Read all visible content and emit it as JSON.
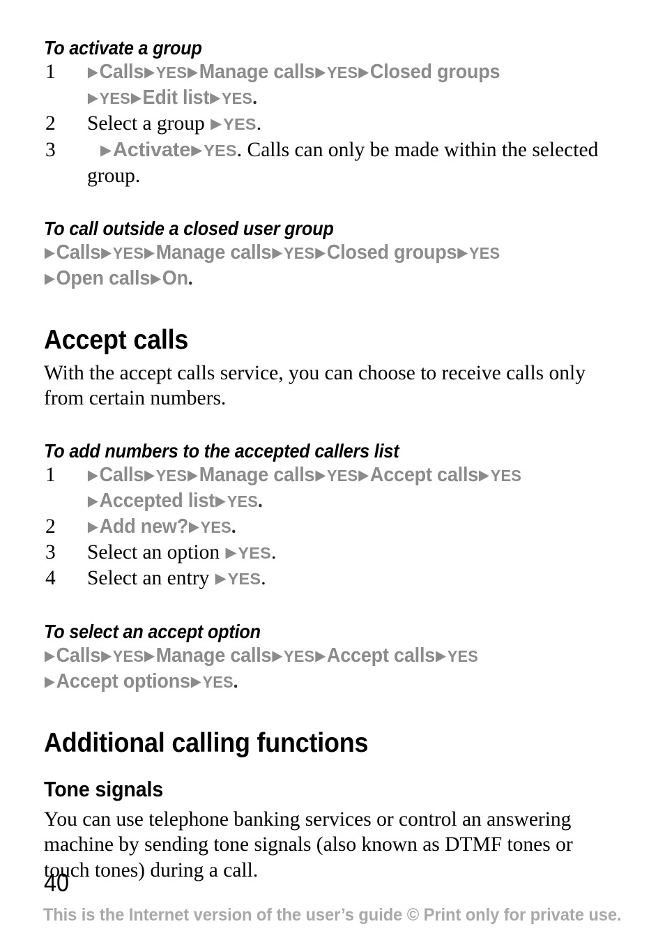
{
  "document": {
    "page_number": "40",
    "footer_notice": "This is the Internet version of the user’s guide © Print only for private use.",
    "colors": {
      "menu_path_grey": "#8b8b8b",
      "footer_grey": "#a9a9a9",
      "text_black": "#000000",
      "page_background": "#ffffff"
    },
    "arrow_glyph": "▶"
  },
  "sections": [
    {
      "id": "to-activate-a-group",
      "heading": "To activate a group",
      "heading_level": "h3",
      "steps": [
        {
          "number": "1",
          "lines": [
            {
              "type": "path",
              "tokens": [
                {
                  "t": "arrow"
                },
                {
                  "t": "label",
                  "v": "Calls"
                },
                {
                  "t": "arrow"
                },
                {
                  "t": "yes",
                  "v": "YES"
                },
                {
                  "t": "arrow"
                },
                {
                  "t": "label",
                  "v": "Manage calls"
                },
                {
                  "t": "arrow"
                },
                {
                  "t": "yes",
                  "v": "YES"
                },
                {
                  "t": "arrow"
                },
                {
                  "t": "label",
                  "v": "Closed groups"
                }
              ]
            },
            {
              "type": "path",
              "tokens": [
                {
                  "t": "arrow"
                },
                {
                  "t": "yes",
                  "v": "YES"
                },
                {
                  "t": "arrow"
                },
                {
                  "t": "label",
                  "v": "Edit list"
                },
                {
                  "t": "arrow"
                },
                {
                  "t": "yes",
                  "v": "YES"
                },
                {
                  "t": "period",
                  "v": "."
                }
              ]
            }
          ]
        },
        {
          "number": "2",
          "text_before": "Select a group ",
          "lines": [
            {
              "type": "mixed",
              "tokens": [
                {
                  "t": "arrow"
                },
                {
                  "t": "yes",
                  "v": "YES"
                },
                {
                  "t": "period",
                  "v": "."
                }
              ]
            }
          ]
        },
        {
          "number": "3",
          "lines": [
            {
              "type": "mixed",
              "tokens": [
                {
                  "t": "arrow"
                },
                {
                  "t": "label",
                  "v": "Activate"
                },
                {
                  "t": "arrow"
                },
                {
                  "t": "yes",
                  "v": "YES"
                },
                {
                  "t": "period",
                  "v": "."
                }
              ]
            }
          ],
          "text_after": " Calls can only be made within the selected group."
        }
      ]
    },
    {
      "id": "to-call-outside-a-closed-user-group",
      "heading": "To call outside a closed user group",
      "heading_level": "h3",
      "path_lines": [
        {
          "tokens": [
            {
              "t": "arrow"
            },
            {
              "t": "label",
              "v": "Calls"
            },
            {
              "t": "arrow"
            },
            {
              "t": "yes",
              "v": "YES"
            },
            {
              "t": "arrow"
            },
            {
              "t": "label",
              "v": "Manage calls"
            },
            {
              "t": "arrow"
            },
            {
              "t": "yes",
              "v": "YES"
            },
            {
              "t": "arrow"
            },
            {
              "t": "label",
              "v": "Closed groups"
            },
            {
              "t": "arrow"
            },
            {
              "t": "yes",
              "v": "YES"
            }
          ]
        },
        {
          "tokens": [
            {
              "t": "arrow"
            },
            {
              "t": "label",
              "v": "Open calls"
            },
            {
              "t": "arrow"
            },
            {
              "t": "label",
              "v": "On"
            },
            {
              "t": "period",
              "v": "."
            }
          ]
        }
      ]
    },
    {
      "id": "accept-calls",
      "heading": "Accept calls",
      "heading_level": "h1",
      "paragraph": "With the accept calls service, you can choose to receive calls only from certain numbers."
    },
    {
      "id": "to-add-numbers-to-the-accepted-callers-list",
      "heading": "To add numbers to the accepted callers list",
      "heading_level": "h3",
      "steps": [
        {
          "number": "1",
          "lines": [
            {
              "type": "path",
              "tokens": [
                {
                  "t": "arrow"
                },
                {
                  "t": "label",
                  "v": "Calls"
                },
                {
                  "t": "arrow"
                },
                {
                  "t": "yes",
                  "v": "YES"
                },
                {
                  "t": "arrow"
                },
                {
                  "t": "label",
                  "v": "Manage calls"
                },
                {
                  "t": "arrow"
                },
                {
                  "t": "yes",
                  "v": "YES"
                },
                {
                  "t": "arrow"
                },
                {
                  "t": "label",
                  "v": "Accept calls"
                },
                {
                  "t": "arrow"
                },
                {
                  "t": "yes",
                  "v": "YES"
                }
              ]
            },
            {
              "type": "path",
              "tokens": [
                {
                  "t": "arrow"
                },
                {
                  "t": "label",
                  "v": "Accepted list"
                },
                {
                  "t": "arrow"
                },
                {
                  "t": "yes",
                  "v": "YES"
                },
                {
                  "t": "period",
                  "v": "."
                }
              ]
            }
          ]
        },
        {
          "number": "2",
          "lines": [
            {
              "type": "path",
              "tokens": [
                {
                  "t": "arrow"
                },
                {
                  "t": "label",
                  "v": "Add new?"
                },
                {
                  "t": "arrow"
                },
                {
                  "t": "yes",
                  "v": "YES"
                },
                {
                  "t": "period",
                  "v": "."
                }
              ]
            }
          ]
        },
        {
          "number": "3",
          "text_before": "Select an option ",
          "lines": [
            {
              "type": "mixed",
              "tokens": [
                {
                  "t": "arrow"
                },
                {
                  "t": "yes",
                  "v": "YES"
                },
                {
                  "t": "period",
                  "v": "."
                }
              ]
            }
          ]
        },
        {
          "number": "4",
          "text_before": "Select an entry ",
          "lines": [
            {
              "type": "mixed",
              "tokens": [
                {
                  "t": "arrow"
                },
                {
                  "t": "yes",
                  "v": "YES"
                },
                {
                  "t": "period",
                  "v": "."
                }
              ]
            }
          ]
        }
      ]
    },
    {
      "id": "to-select-an-accept-option",
      "heading": "To select an accept option",
      "heading_level": "h3",
      "path_lines": [
        {
          "tokens": [
            {
              "t": "arrow"
            },
            {
              "t": "label",
              "v": "Calls"
            },
            {
              "t": "arrow"
            },
            {
              "t": "yes",
              "v": "YES"
            },
            {
              "t": "arrow"
            },
            {
              "t": "label",
              "v": "Manage calls"
            },
            {
              "t": "arrow"
            },
            {
              "t": "yes",
              "v": "YES"
            },
            {
              "t": "arrow"
            },
            {
              "t": "label",
              "v": "Accept calls"
            },
            {
              "t": "arrow"
            },
            {
              "t": "yes",
              "v": "YES"
            }
          ]
        },
        {
          "tokens": [
            {
              "t": "arrow"
            },
            {
              "t": "label",
              "v": "Accept options"
            },
            {
              "t": "arrow"
            },
            {
              "t": "yes",
              "v": "YES"
            },
            {
              "t": "period",
              "v": "."
            }
          ]
        }
      ]
    },
    {
      "id": "additional-calling-functions",
      "heading": "Additional calling functions",
      "heading_level": "h1"
    },
    {
      "id": "tone-signals",
      "heading": "Tone signals",
      "heading_level": "h2",
      "paragraph": "You can use telephone banking services or control an answering machine by sending tone signals (also known as DTMF tones or touch tones) during a call."
    }
  ]
}
